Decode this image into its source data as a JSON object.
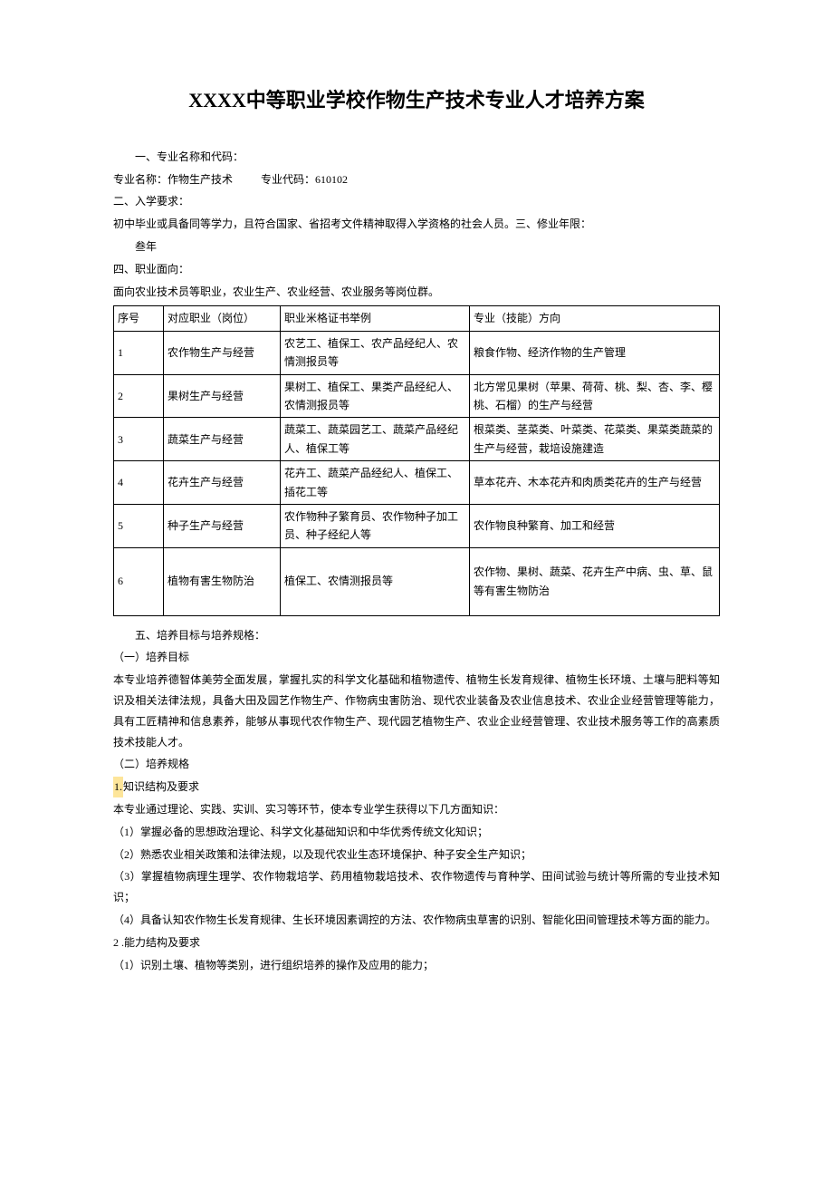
{
  "title": "XXXX中等职业学校作物生产技术专业人才培养方案",
  "sections": {
    "s1_label": "一、专业名称和代码：",
    "major_name_label": "专业名称：作物生产技术",
    "major_code_label": "专业代码：610102",
    "s2_label": "二、入学要求：",
    "s2_body": "初中毕业或具备同等学力，且符合国家、省招考文件精神取得入学资格的社会人员。三、修业年限：",
    "s3_body": "叁年",
    "s4_label": "四、职业面向：",
    "s4_body": "面向农业技术员等职业，农业生产、农业经营、农业服务等岗位群。"
  },
  "table": {
    "headers": {
      "h1": "序号",
      "h2": "对应职业（岗位）",
      "h3": "职业米格证书举例",
      "h4": "专业（技能）方向"
    },
    "rows": [
      {
        "no": "1",
        "job": "农作物生产与经营",
        "cert": "农艺工、植保工、农产品经纪人、农情测报员等",
        "dir": "粮食作物、经济作物的生产管理"
      },
      {
        "no": "2",
        "job": "果树生产与经营",
        "cert": "果树工、植保工、果类产品经纪人、农情测报员等",
        "dir": "北方常见果树（苹果、荷荷、桃、梨、杏、李、樱桃、石榴）的生产与经营"
      },
      {
        "no": "3",
        "job": "蔬菜生产与经营",
        "cert": "蔬菜工、蔬菜园艺工、蔬菜产品经纪人、植保工等",
        "dir": "根菜类、茎菜类、叶菜类、花菜类、果菜类蔬菜的生产与经营，栽培设施建造"
      },
      {
        "no": "4",
        "job": "花卉生产与经营",
        "cert": "花卉工、蔬菜产品经纪人、植保工、插花工等",
        "dir": "草本花卉、木本花卉和肉质类花卉的生产与经营"
      },
      {
        "no": "5",
        "job": "种子生产与经营",
        "cert": "农作物种子繁育员、农作物种子加工员、种子经纪人等",
        "dir": "农作物良种繁育、加工和经营"
      },
      {
        "no": "6",
        "job": "植物有害生物防治",
        "cert": "植保工、农情测报员等",
        "dir": "农作物、果树、蔬菜、花卉生产中病、虫、草、鼠等有害生物防治"
      }
    ]
  },
  "post": {
    "s5_label": "五、培养目标与培养规格：",
    "p1": "（一）培养目标",
    "p2": "本专业培养德智体美劳全面发展，掌握扎实的科学文化基础和植物遗传、植物生长发育规律、植物生长环境、土壤与肥料等知识及相关法律法规，具备大田及园艺作物生产、作物病虫害防治、现代农业装备及农业信息技术、农业企业经营管理等能力，具有工匠精神和信息素养，能够从事现代农作物生产、现代园艺植物生产、农业企业经营管理、农业技术服务等工作的高素质技术技能人才。",
    "p3": "（二）培养规格",
    "p4_hl": "1.",
    "p4_rest": "知识结构及要求",
    "p5": "本专业通过理论、实践、实训、实习等环节，使本专业学生获得以下几方面知识：",
    "p6": "（1）掌握必备的思想政治理论、科学文化基础知识和中华优秀传统文化知识；",
    "p7": "（2）熟悉农业相关政策和法律法规，以及现代农业生态环境保护、种子安全生产知识；",
    "p8": "（3）掌握植物病理生理学、农作物栽培学、药用植物栽培技术、农作物遗传与育种学、田间试验与统计等所需的专业技术知识；",
    "p9": "（4）具备认知农作物生长发育规律、生长环境因素调控的方法、农作物病虫草害的识别、智能化田间管理技术等方面的能力。",
    "p10": "2  .能力结构及要求",
    "p11": "（1）识别土壤、植物等类别，进行组织培养的操作及应用的能力；"
  }
}
